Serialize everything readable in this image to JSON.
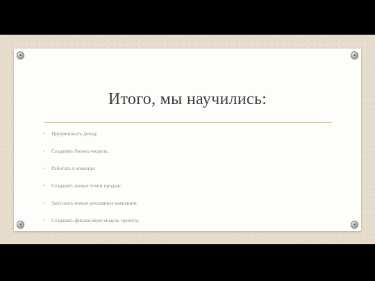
{
  "slide": {
    "title": "Итого, мы научились:",
    "bullets": [
      "Приумножать доход;",
      "Создавать бизнес-модель;",
      "Работать в команде;",
      "Создавать новые точки продаж;",
      "Запускать новые рекламные кампании;",
      "Создавать финансовую модель проекта."
    ],
    "bullet_glyph": "•"
  },
  "colors": {
    "background": "#000000",
    "board": "#e6dccb",
    "paper": "#fdfdfc",
    "accent_rule": "#e7c58b",
    "title_text": "#3b3b3b",
    "body_text": "#8b8b8b"
  },
  "icons": [
    "pushpin-icon"
  ]
}
